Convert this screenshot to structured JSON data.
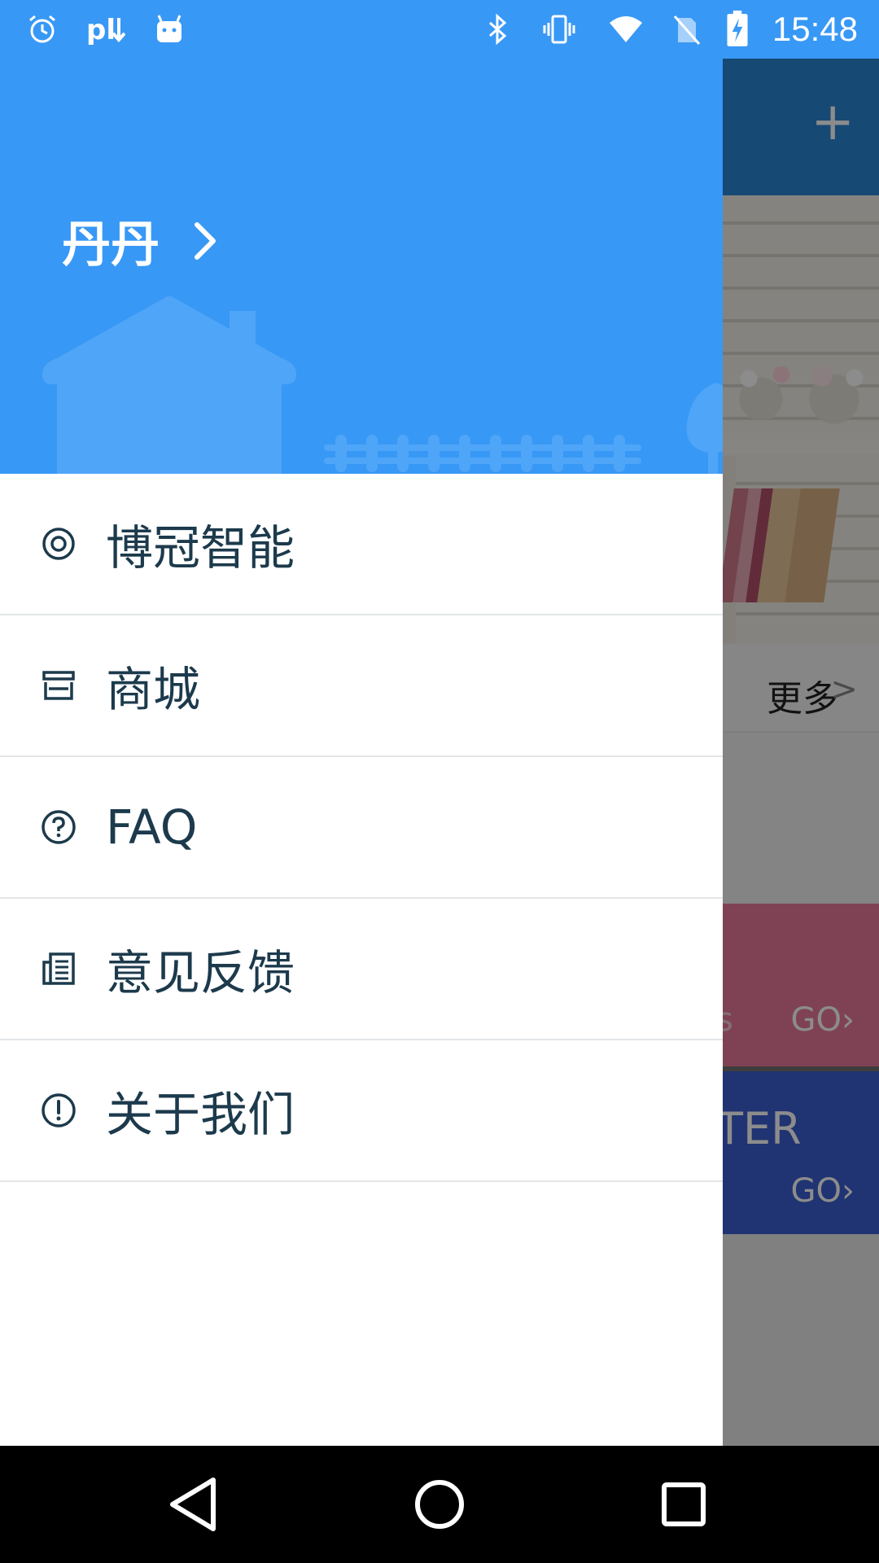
{
  "status_bar": {
    "time": "15:48",
    "left_icons": [
      "alarm-icon",
      "pl-download-icon",
      "android-icon"
    ],
    "right_icons": [
      "bluetooth-icon",
      "vibrate-icon",
      "wifi-icon",
      "no-sim-icon",
      "battery-charging-icon"
    ],
    "pl_text": "pl"
  },
  "drawer": {
    "user_name": "丹丹",
    "header_color": "#3898f5",
    "items": [
      {
        "label": "博冠智能",
        "icon": "target-icon"
      },
      {
        "label": "商城",
        "icon": "store-icon"
      },
      {
        "label": "FAQ",
        "icon": "help-icon"
      },
      {
        "label": "意见反馈",
        "icon": "feedback-icon"
      },
      {
        "label": "关于我们",
        "icon": "info-icon"
      }
    ],
    "text_color": "#1c3a4c"
  },
  "background_app": {
    "toolbar_action": "+",
    "more_label": "更多",
    "more_arrow": ">",
    "pink_card_go": "GO›",
    "pink_card_partial": "s",
    "blue_card_title_partial": "TER",
    "blue_card_go": "GO›"
  },
  "nav_bar": {
    "buttons": [
      "back-icon",
      "home-icon",
      "recents-icon"
    ]
  }
}
